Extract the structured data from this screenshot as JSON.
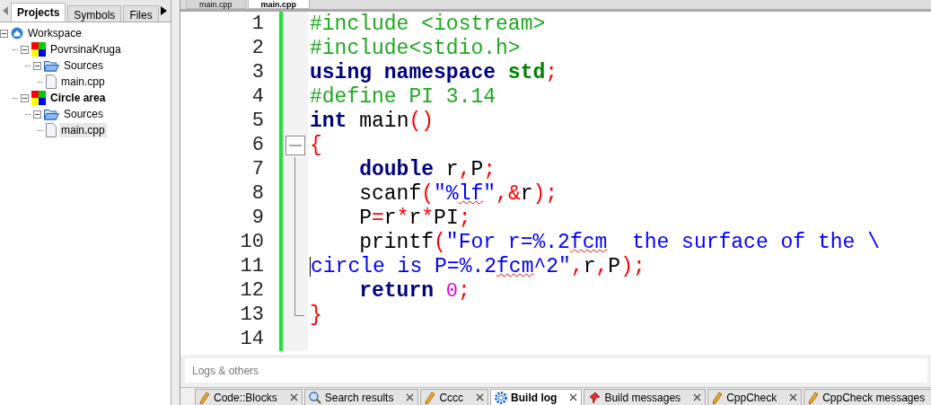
{
  "sidebar": {
    "tabs": [
      {
        "label": "Projects",
        "selected": true
      },
      {
        "label": "Symbols",
        "selected": false
      },
      {
        "label": "Files",
        "selected": false
      }
    ],
    "tree": [
      {
        "label": "Workspace",
        "kind": "workspace",
        "active": false,
        "selected": false,
        "expanded": true,
        "children": [
          {
            "label": "PovrsinaKruga",
            "kind": "project",
            "active": false,
            "selected": false,
            "expanded": true,
            "children": [
              {
                "label": "Sources",
                "kind": "folder",
                "active": false,
                "selected": false,
                "expanded": true,
                "children": [
                  {
                    "label": "main.cpp",
                    "kind": "file",
                    "active": false,
                    "selected": false
                  }
                ]
              }
            ]
          },
          {
            "label": "Circle area",
            "kind": "project",
            "active": true,
            "selected": false,
            "expanded": true,
            "children": [
              {
                "label": "Sources",
                "kind": "folder",
                "active": false,
                "selected": false,
                "expanded": true,
                "children": [
                  {
                    "label": "main.cpp",
                    "kind": "file",
                    "active": false,
                    "selected": true
                  }
                ]
              }
            ]
          }
        ]
      }
    ]
  },
  "editor": {
    "tabs": [
      {
        "label": "main.cpp",
        "selected": false
      },
      {
        "label": "main.cpp",
        "selected": true
      }
    ],
    "lines": [
      {
        "number": "1",
        "tokens": [
          {
            "kind": "pp",
            "text": "#include <iostream>"
          }
        ]
      },
      {
        "number": "2",
        "tokens": [
          {
            "kind": "pp",
            "text": "#include<stdio.h>"
          }
        ]
      },
      {
        "number": "3",
        "tokens": [
          {
            "kind": "kw",
            "text": "using namespace "
          },
          {
            "kind": "ns",
            "text": "std"
          },
          {
            "kind": "op",
            "text": ";"
          }
        ]
      },
      {
        "number": "4",
        "tokens": [
          {
            "kind": "pp",
            "text": "#define PI 3.14"
          }
        ]
      },
      {
        "number": "5",
        "tokens": [
          {
            "kind": "kw",
            "text": "int"
          },
          {
            "kind": "id",
            "text": " main"
          },
          {
            "kind": "op",
            "text": "()"
          }
        ]
      },
      {
        "number": "6",
        "fold_start": true,
        "expanded": true,
        "tokens": [
          {
            "kind": "op",
            "text": "{"
          }
        ]
      },
      {
        "number": "7",
        "tokens": [
          {
            "kind": "kw",
            "text": "    double"
          },
          {
            "kind": "id",
            "text": " r"
          },
          {
            "kind": "op",
            "text": ","
          },
          {
            "kind": "id",
            "text": "P"
          },
          {
            "kind": "op",
            "text": ";"
          }
        ]
      },
      {
        "number": "8",
        "tokens": [
          {
            "kind": "id",
            "text": "    scanf"
          },
          {
            "kind": "op",
            "text": "("
          },
          {
            "kind": "str",
            "text": "\"%"
          },
          {
            "kind": "misspelled",
            "text": "lf"
          },
          {
            "kind": "str",
            "text": "\""
          },
          {
            "kind": "op",
            "text": ",&"
          },
          {
            "kind": "id",
            "text": "r"
          },
          {
            "kind": "op",
            "text": ");"
          }
        ]
      },
      {
        "number": "9",
        "tokens": [
          {
            "kind": "id",
            "text": "    P"
          },
          {
            "kind": "op",
            "text": "="
          },
          {
            "kind": "id",
            "text": "r"
          },
          {
            "kind": "op",
            "text": "*"
          },
          {
            "kind": "id",
            "text": "r"
          },
          {
            "kind": "op",
            "text": "*"
          },
          {
            "kind": "id",
            "text": "PI"
          },
          {
            "kind": "op",
            "text": ";"
          }
        ]
      },
      {
        "number": "10",
        "tokens": [
          {
            "kind": "id",
            "text": "    printf"
          },
          {
            "kind": "op",
            "text": "("
          },
          {
            "kind": "str",
            "text": "\"For r=%.2"
          },
          {
            "kind": "misspelled",
            "text": "fcm"
          },
          {
            "kind": "str",
            "text": "  the surface of the \\"
          }
        ]
      },
      {
        "number": "11",
        "cursor": true,
        "tokens": [
          {
            "kind": "str",
            "text": "circle is P=%.2"
          },
          {
            "kind": "misspelled",
            "text": "fcm"
          },
          {
            "kind": "str",
            "text": "^2\""
          },
          {
            "kind": "op",
            "text": ","
          },
          {
            "kind": "id",
            "text": "r"
          },
          {
            "kind": "op",
            "text": ","
          },
          {
            "kind": "id",
            "text": "P"
          },
          {
            "kind": "op",
            "text": ");"
          }
        ]
      },
      {
        "number": "12",
        "tokens": [
          {
            "kind": "kw",
            "text": "    return "
          },
          {
            "kind": "num",
            "text": "0"
          },
          {
            "kind": "op",
            "text": ";"
          }
        ]
      },
      {
        "number": "13",
        "fold_end": true,
        "tokens": [
          {
            "kind": "op",
            "text": "}"
          }
        ]
      },
      {
        "number": "14"
      }
    ]
  },
  "logs": {
    "title": "Logs & others",
    "tabs": [
      {
        "label": "Code::Blocks",
        "kind": "pencil",
        "selected": false
      },
      {
        "label": "Search results",
        "kind": "search",
        "selected": false
      },
      {
        "label": "Cccc",
        "kind": "pencil",
        "selected": false
      },
      {
        "label": "Build log",
        "kind": "gear",
        "selected": true
      },
      {
        "label": "Build messages",
        "kind": "pin",
        "selected": false
      },
      {
        "label": "CppCheck",
        "kind": "pencil",
        "selected": false
      },
      {
        "label": "CppCheck messages",
        "kind": "pencil",
        "selected": false
      }
    ]
  }
}
